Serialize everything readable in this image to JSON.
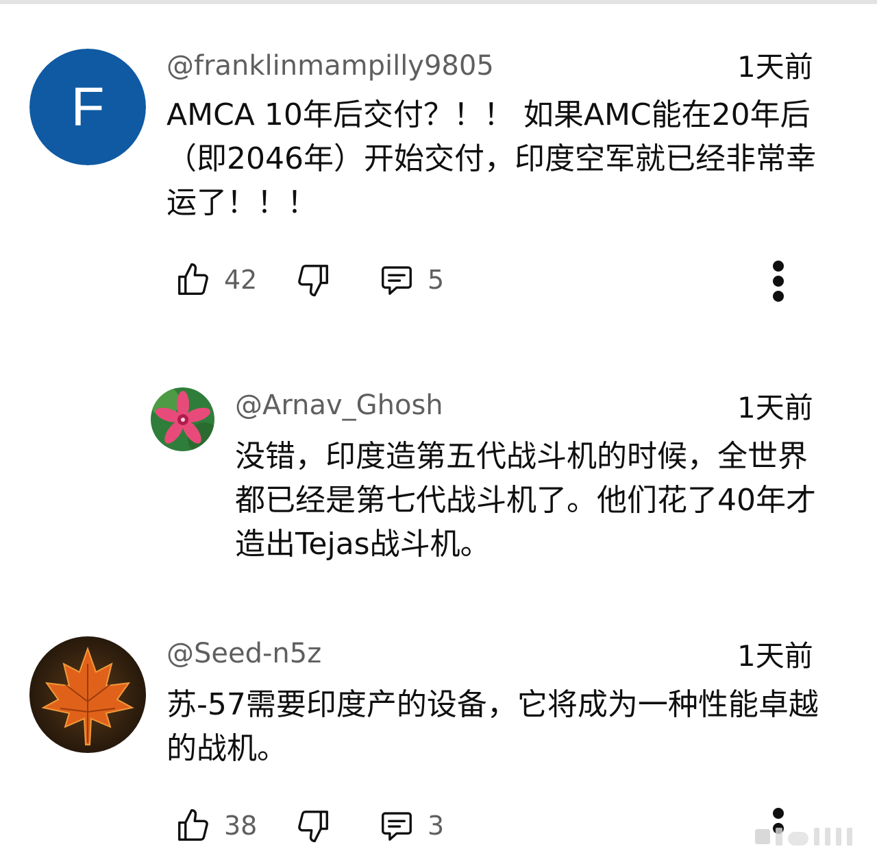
{
  "comments": [
    {
      "handle": "@franklinmampilly9805",
      "time": "1天前",
      "avatar_letter": "F",
      "avatar_color": "#0f5aa3",
      "text": "AMCA 10年后交付？！！ 如果AMC能在20年后（即2046年）开始交付，印度空军就已经非常幸运了！！！",
      "likes": "42",
      "replies": "5"
    },
    {
      "handle": "@Arnav_Ghosh",
      "time": "1天前",
      "avatar_icon": "pink-flower-icon",
      "text": "没错，印度造第五代战斗机的时候，全世界都已经是第七代战斗机了。他们花了40年才造出Tejas战斗机。"
    },
    {
      "handle": "@Seed-n5z",
      "time": "1天前",
      "avatar_icon": "maple-leaf-icon",
      "text": "苏-57需要印度产的设备，它将成为一种性能卓越的战机。",
      "likes": "38",
      "replies": "3"
    }
  ],
  "icons": {
    "like": "thumbs-up-icon",
    "dislike": "thumbs-down-icon",
    "reply": "reply-comment-icon",
    "more": "more-vertical-icon"
  }
}
